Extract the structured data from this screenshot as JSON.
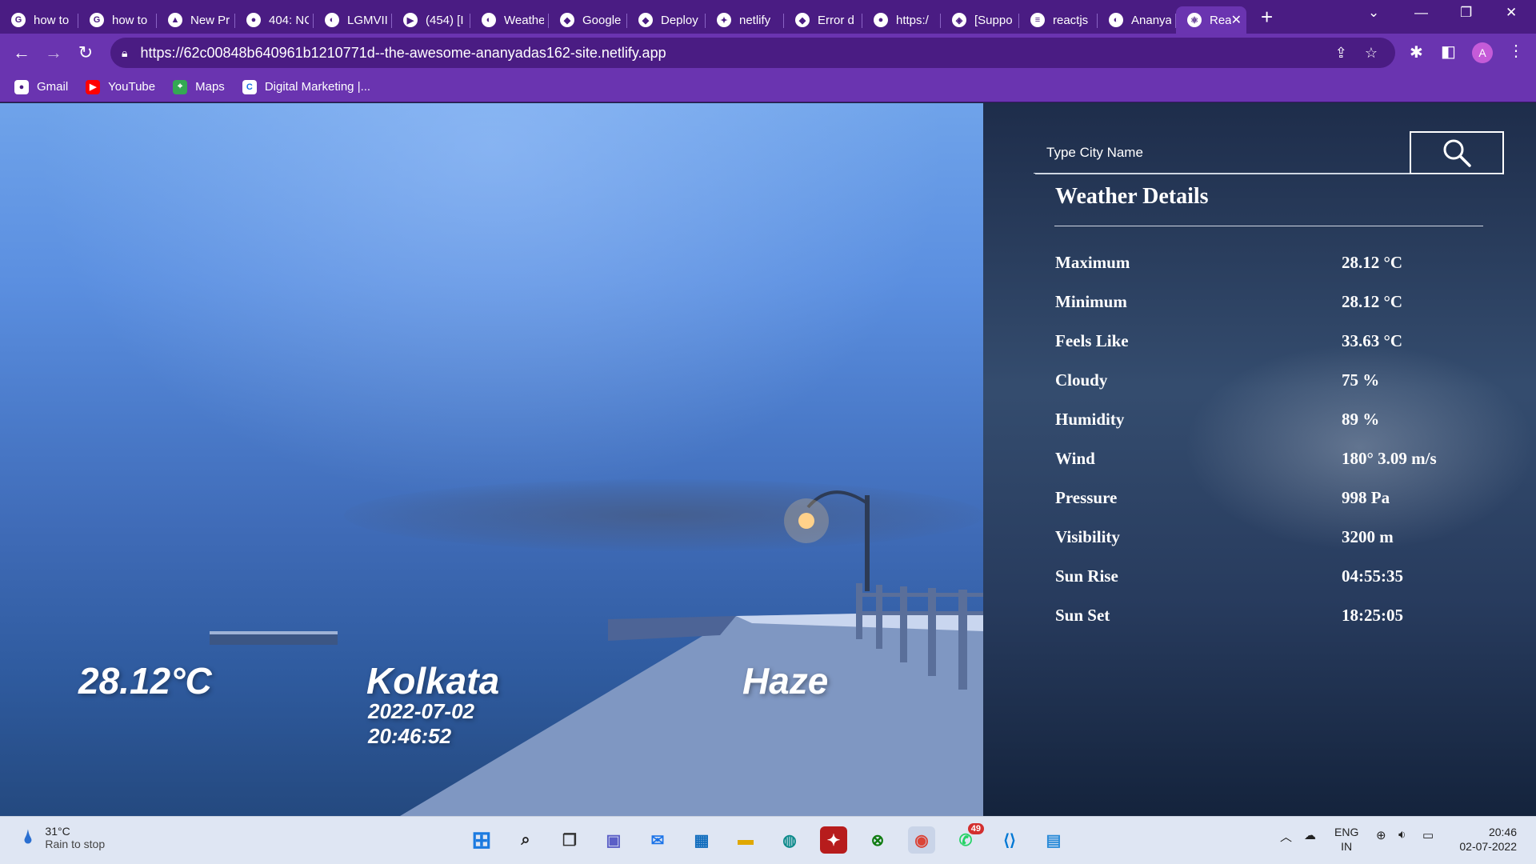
{
  "browser": {
    "tabs": [
      {
        "title": "how to",
        "icon": "google-icon"
      },
      {
        "title": "how to",
        "icon": "google-icon"
      },
      {
        "title": "New Pr",
        "icon": "triangle-icon"
      },
      {
        "title": "404: NC",
        "icon": "globe-icon"
      },
      {
        "title": "LGMVII",
        "icon": "github-icon"
      },
      {
        "title": "(454) [I",
        "icon": "youtube-icon"
      },
      {
        "title": "Weathe",
        "icon": "github-icon"
      },
      {
        "title": "Google",
        "icon": "google-cloud-icon"
      },
      {
        "title": "Deploy",
        "icon": "netlify-icon"
      },
      {
        "title": "netlify",
        "icon": "netlify-spark-icon"
      },
      {
        "title": "Error d",
        "icon": "netlify-icon"
      },
      {
        "title": "https:/",
        "icon": "globe-icon"
      },
      {
        "title": "[Suppo",
        "icon": "forum-icon"
      },
      {
        "title": "reactjs",
        "icon": "stackoverflow-icon"
      },
      {
        "title": "Ananya",
        "icon": "github-icon"
      },
      {
        "title": "Rea",
        "icon": "react-icon",
        "active": true
      }
    ],
    "url": "https://62c00848b640961b1210771d--the-awesome-ananyadas162-site.netlify.app",
    "bookmarks": [
      {
        "label": "Gmail",
        "icon": "globe-icon"
      },
      {
        "label": "YouTube",
        "icon": "youtube-icon"
      },
      {
        "label": "Maps",
        "icon": "maps-icon"
      },
      {
        "label": "Digital Marketing |...",
        "icon": "c-icon"
      }
    ],
    "profile_initial": "A",
    "colors": {
      "tab_bar": "#4a1c83",
      "toolbar": "#6a34b0"
    }
  },
  "weather": {
    "temperature": "28.12°C",
    "city": "Kolkata",
    "date": "2022-07-02",
    "time": "20:46:52",
    "condition": "Haze",
    "search_placeholder": "Type City Name",
    "details_title": "Weather Details",
    "details": [
      {
        "label": "Maximum",
        "value": "28.12 °C"
      },
      {
        "label": "Minimum",
        "value": "28.12 °C"
      },
      {
        "label": "Feels Like",
        "value": "33.63 °C"
      },
      {
        "label": "Cloudy",
        "value": "75 %"
      },
      {
        "label": "Humidity",
        "value": "89 %"
      },
      {
        "label": "Wind",
        "value": "180° 3.09 m/s"
      },
      {
        "label": "Pressure",
        "value": "998 Pa"
      },
      {
        "label": "Visibility",
        "value": "3200 m"
      },
      {
        "label": "Sun Rise",
        "value": "04:55:35"
      },
      {
        "label": "Sun Set",
        "value": "18:25:05"
      }
    ]
  },
  "taskbar": {
    "weather_temp": "31°C",
    "weather_desc": "Rain to stop",
    "whatsapp_badge": "49",
    "lang_top": "ENG",
    "lang_bottom": "IN",
    "clock_time": "20:46",
    "clock_date": "02-07-2022"
  }
}
